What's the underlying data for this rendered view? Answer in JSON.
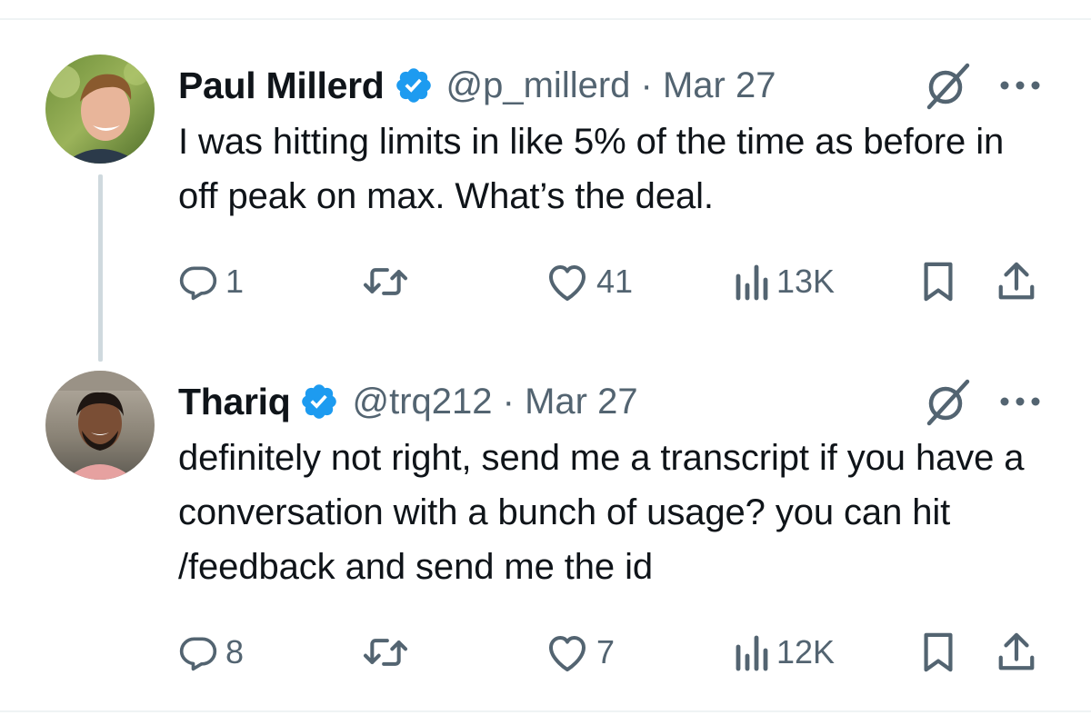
{
  "tweets": [
    {
      "author": {
        "name": "Paul Millerd",
        "handle": "@p_millerd",
        "verified": true
      },
      "separator": "·",
      "date": "Mar 27",
      "text": "I was hitting limits in like 5% of the time as before in off peak on max. What’s the deal.",
      "actions": {
        "replies": "1",
        "retweets": "",
        "likes": "41",
        "views": "13K"
      }
    },
    {
      "author": {
        "name": "Thariq",
        "handle": "@trq212",
        "verified": true
      },
      "separator": "·",
      "date": "Mar 27",
      "text": "definitely not right, send me a transcript if you have a conversation with a bunch of usage? you can hit /feedback and send me the id",
      "actions": {
        "replies": "8",
        "retweets": "",
        "likes": "7",
        "views": "12K"
      }
    }
  ],
  "icons": {
    "verified": "verified-badge-icon",
    "grok": "grok-icon",
    "more": "more-options-icon",
    "reply": "reply-icon",
    "retweet": "retweet-icon",
    "like": "heart-icon",
    "views": "views-chart-icon",
    "bookmark": "bookmark-icon",
    "share": "share-icon"
  },
  "colors": {
    "text": "#0f1419",
    "secondary": "#536471",
    "verified": "#1d9bf0",
    "thread_line": "#cfd9de"
  }
}
